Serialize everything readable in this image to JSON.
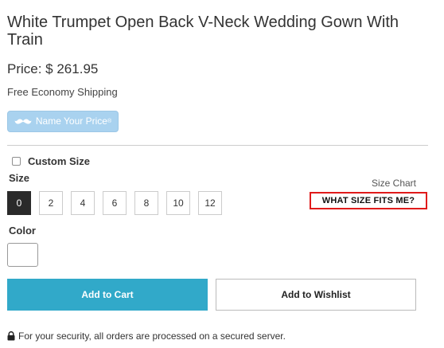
{
  "product": {
    "title": "White Trumpet Open Back V-Neck Wedding Gown With Train",
    "price_label": "Price: $ 261.95",
    "shipping": "Free Economy Shipping"
  },
  "name_your_price": {
    "label": "Name Your Price",
    "trademark": "®",
    "icon": "mustache-icon"
  },
  "custom_size": {
    "label": "Custom Size",
    "checked": false
  },
  "size": {
    "heading": "Size",
    "chart_link": "Size Chart",
    "fit_link": "WHAT SIZE FITS ME?",
    "options": [
      "0",
      "2",
      "4",
      "6",
      "8",
      "10",
      "12"
    ],
    "selected": "0"
  },
  "color": {
    "heading": "Color",
    "swatch": "#ffffff"
  },
  "actions": {
    "add_to_cart": "Add to Cart",
    "add_to_wishlist": "Add to Wishlist"
  },
  "security": {
    "icon": "lock-icon",
    "text": "For your security, all orders are processed on a secured server."
  },
  "colors": {
    "accent": "#31a9c9",
    "name_your_price_bg": "#a9d2ef",
    "highlight_border": "#e01b1b",
    "selected_size_bg": "#2a2a2a"
  }
}
